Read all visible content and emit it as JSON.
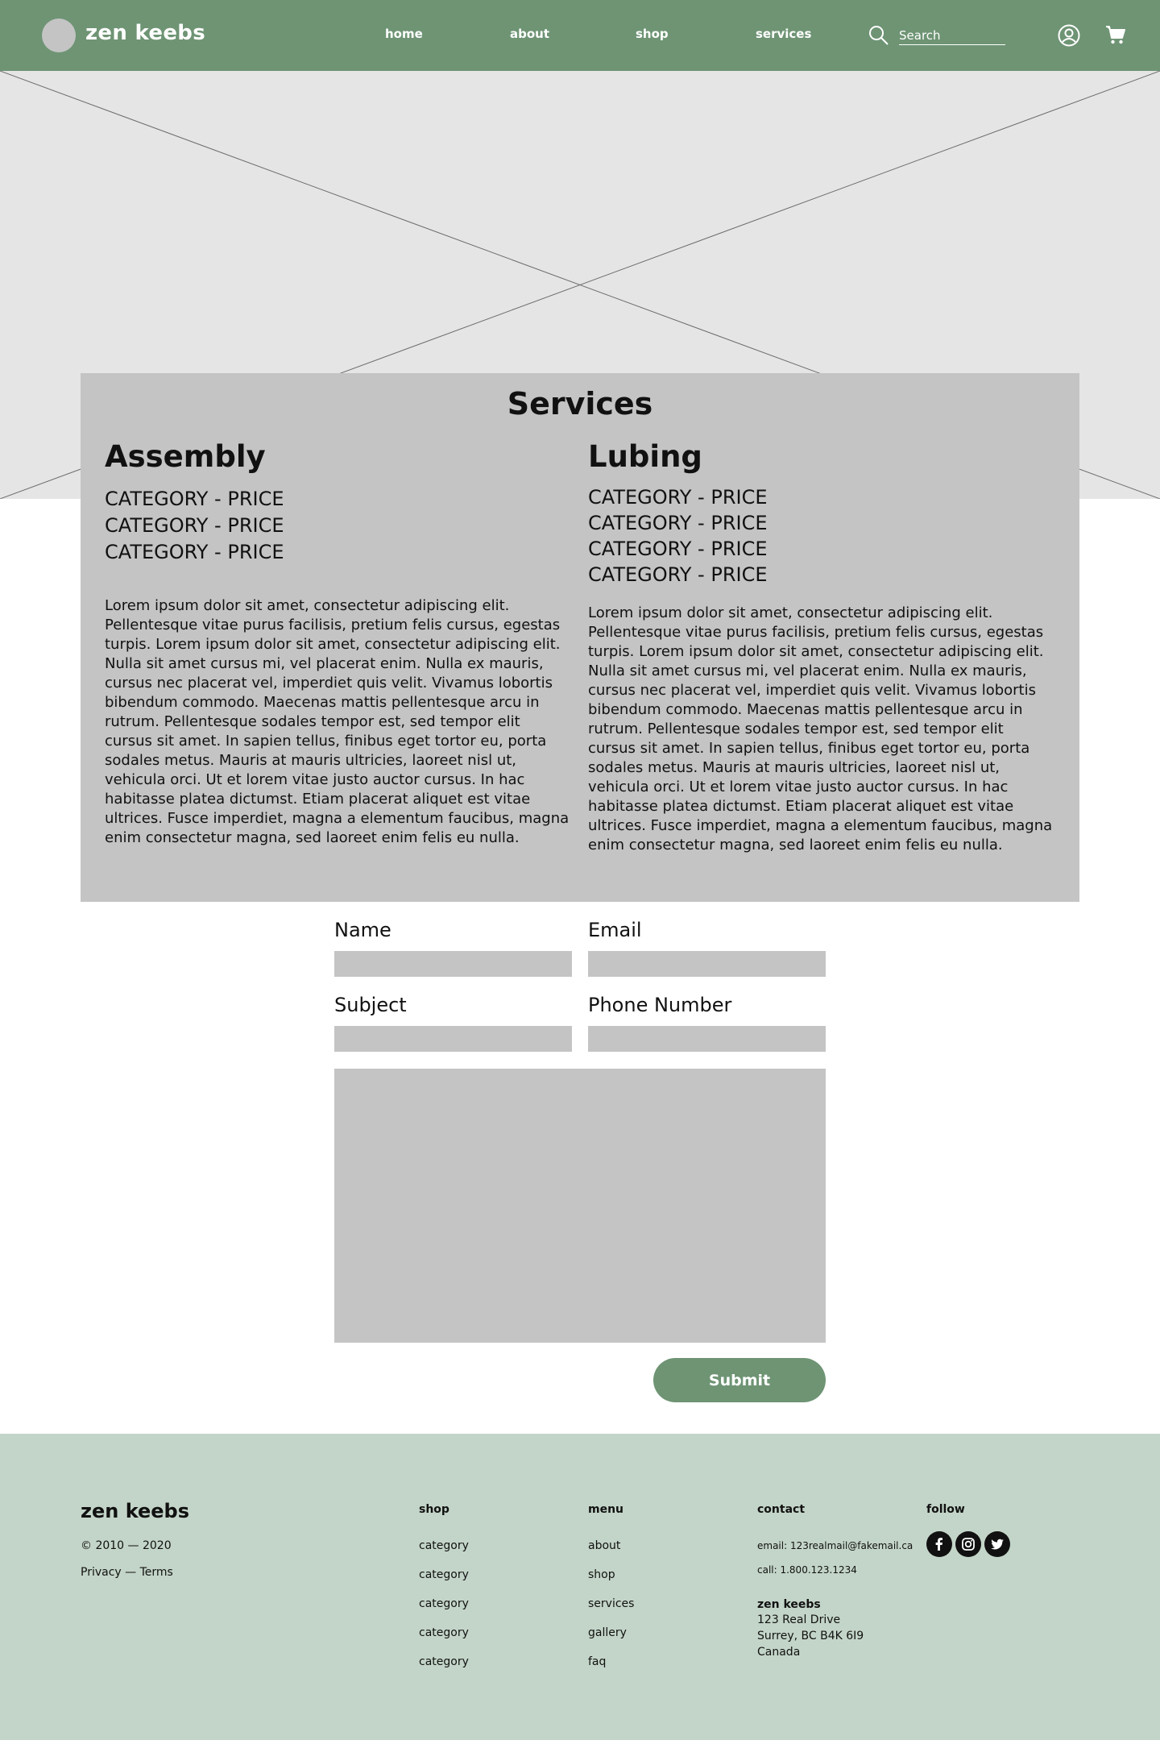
{
  "nav": {
    "brand": "zen keebs",
    "links": [
      "home",
      "about",
      "shop",
      "services"
    ],
    "search_placeholder": "Search"
  },
  "services": {
    "title": "Services",
    "assembly": {
      "heading": "Assembly",
      "prices": [
        "CATEGORY - PRICE",
        "CATEGORY - PRICE",
        "CATEGORY - PRICE"
      ],
      "description": "Lorem ipsum dolor sit amet, consectetur adipiscing elit. Pellentesque vitae purus facilisis, pretium felis cursus, egestas turpis. Lorem ipsum dolor sit amet, consectetur adipiscing elit. Nulla sit amet cursus mi, vel placerat enim. Nulla ex mauris, cursus nec placerat vel, imperdiet quis velit. Vivamus lobortis bibendum commodo. Maecenas mattis pellentesque arcu in rutrum. Pellentesque sodales tempor est, sed tempor elit cursus sit amet. In sapien tellus, finibus eget tortor eu, porta sodales metus. Mauris at mauris ultricies, laoreet nisl ut, vehicula orci. Ut et lorem vitae justo auctor cursus. In hac habitasse platea dictumst. Etiam placerat aliquet est vitae ultrices. Fusce imperdiet, magna a elementum faucibus, magna enim consectetur magna, sed laoreet enim felis eu nulla."
    },
    "lubing": {
      "heading": "Lubing",
      "prices": [
        "CATEGORY - PRICE",
        "CATEGORY - PRICE",
        "CATEGORY - PRICE",
        "CATEGORY - PRICE"
      ],
      "description": "Lorem ipsum dolor sit amet, consectetur adipiscing elit. Pellentesque vitae purus facilisis, pretium felis cursus, egestas turpis. Lorem ipsum dolor sit amet, consectetur adipiscing elit. Nulla sit amet cursus mi, vel placerat enim. Nulla ex mauris, cursus nec placerat vel, imperdiet quis velit. Vivamus lobortis bibendum commodo. Maecenas mattis pellentesque arcu in rutrum. Pellentesque sodales tempor est, sed tempor elit cursus sit amet. In sapien tellus, finibus eget tortor eu, porta sodales metus. Mauris at mauris ultricies, laoreet nisl ut, vehicula orci. Ut et lorem vitae justo auctor cursus. In hac habitasse platea dictumst. Etiam placerat aliquet est vitae ultrices. Fusce imperdiet, magna a elementum faucibus, magna enim consectetur magna, sed laoreet enim felis eu nulla."
    }
  },
  "form": {
    "name_label": "Name",
    "email_label": "Email",
    "subject_label": "Subject",
    "phone_label": "Phone Number",
    "submit_label": "Submit"
  },
  "footer": {
    "brand": "zen keebs",
    "copyright": "© 2010 — 2020",
    "legal": "Privacy — Terms",
    "shop": {
      "heading": "shop",
      "items": [
        "category",
        "category",
        "category",
        "category",
        "category"
      ]
    },
    "menu": {
      "heading": "menu",
      "items": [
        "about",
        "shop",
        "services",
        "gallery",
        "faq"
      ]
    },
    "contact": {
      "heading": "contact",
      "email": "email: 123realmail@fakemail.ca",
      "phone": "call: 1.800.123.1234",
      "address_name": "zen keebs",
      "address_lines": [
        "123 Real Drive",
        "Surrey, BC B4K 6I9",
        "Canada"
      ]
    },
    "follow": {
      "heading": "follow",
      "icons": [
        "facebook-icon",
        "instagram-icon",
        "twitter-icon"
      ]
    }
  },
  "colors": {
    "nav_green": "#6e9474",
    "footer_green": "#c3d5c8",
    "placeholder_gray": "#c4c4c4",
    "hero_gray": "#e5e5e5"
  }
}
